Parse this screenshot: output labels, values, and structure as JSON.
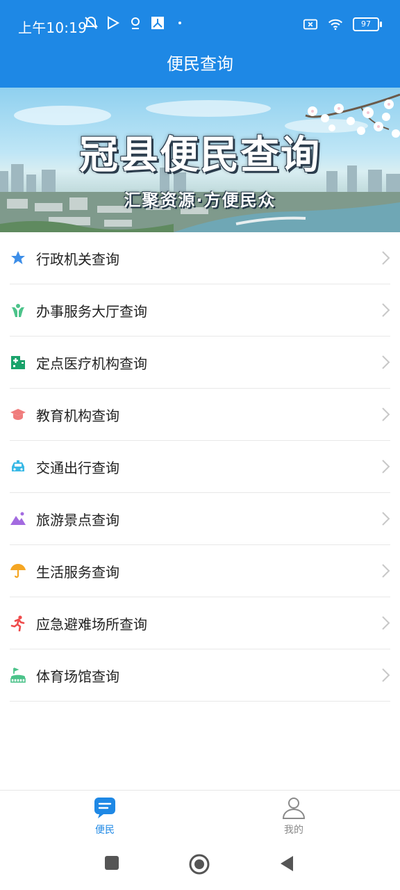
{
  "status_bar": {
    "time": "上午10:19",
    "battery": "97",
    "icons": [
      "mute-alarm-icon",
      "play-store-icon",
      "location-icon",
      "app-icon",
      "dot-icon",
      "sim-x-icon",
      "wifi-icon",
      "battery-icon"
    ]
  },
  "header": {
    "title": "便民查询"
  },
  "banner": {
    "title": "冠县便民查询",
    "subtitle": "汇聚资源·方便民众"
  },
  "menu": {
    "items": [
      {
        "label": "行政机关查询",
        "icon": "star-icon",
        "color": "#3d8ee8"
      },
      {
        "label": "办事服务大厅查询",
        "icon": "hands-icon",
        "color": "#4cc38a"
      },
      {
        "label": "定点医疗机构查询",
        "icon": "hospital-icon",
        "color": "#1aa36b"
      },
      {
        "label": "教育机构查询",
        "icon": "graduation-cap-icon",
        "color": "#f07c7c"
      },
      {
        "label": "交通出行查询",
        "icon": "taxi-icon",
        "color": "#39b9e6"
      },
      {
        "label": "旅游景点查询",
        "icon": "mountain-icon",
        "color": "#a36be0"
      },
      {
        "label": "生活服务查询",
        "icon": "umbrella-icon",
        "color": "#f5a623"
      },
      {
        "label": "应急避难场所查询",
        "icon": "running-person-icon",
        "color": "#ef4b4b"
      },
      {
        "label": "体育场馆查询",
        "icon": "stadium-icon",
        "color": "#4cc38a"
      }
    ]
  },
  "bottom_nav": {
    "items": [
      {
        "label": "便民",
        "active": true,
        "color": "#1e88e5"
      },
      {
        "label": "我的",
        "active": false,
        "color": "#8a8a8a"
      }
    ]
  }
}
